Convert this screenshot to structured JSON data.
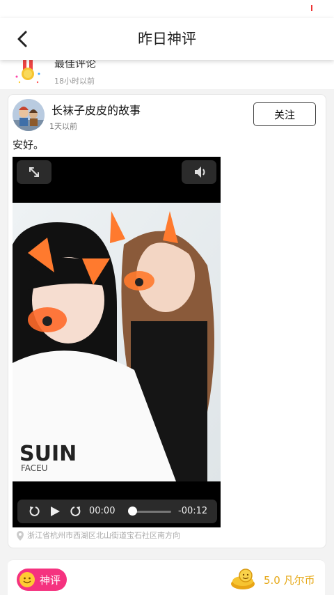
{
  "nav": {
    "title": "昨日神评"
  },
  "previous_item": {
    "title": "最佳评论",
    "time": "18小时以前"
  },
  "post": {
    "username": "长袜子皮皮的故事",
    "time": "1天以前",
    "follow_label": "关注",
    "text": "安好。",
    "video": {
      "current_time": "00:00",
      "remaining_time": "-00:12",
      "progress": 0,
      "photo_caption": "FACEU"
    },
    "location": "浙江省杭州市西湖区北山街道宝石社区南方向"
  },
  "footer": {
    "badge_label": "神评",
    "reward": "5.0 凡尔币"
  },
  "colors": {
    "accent_pink": "#f5327f",
    "reward_gold": "#e6a817"
  },
  "icons": [
    "back-arrow-icon",
    "medal-icon",
    "expand-icon",
    "volume-icon",
    "replay-icon",
    "play-icon",
    "redo-icon",
    "location-pin-icon",
    "emoji-icon",
    "coins-icon"
  ]
}
